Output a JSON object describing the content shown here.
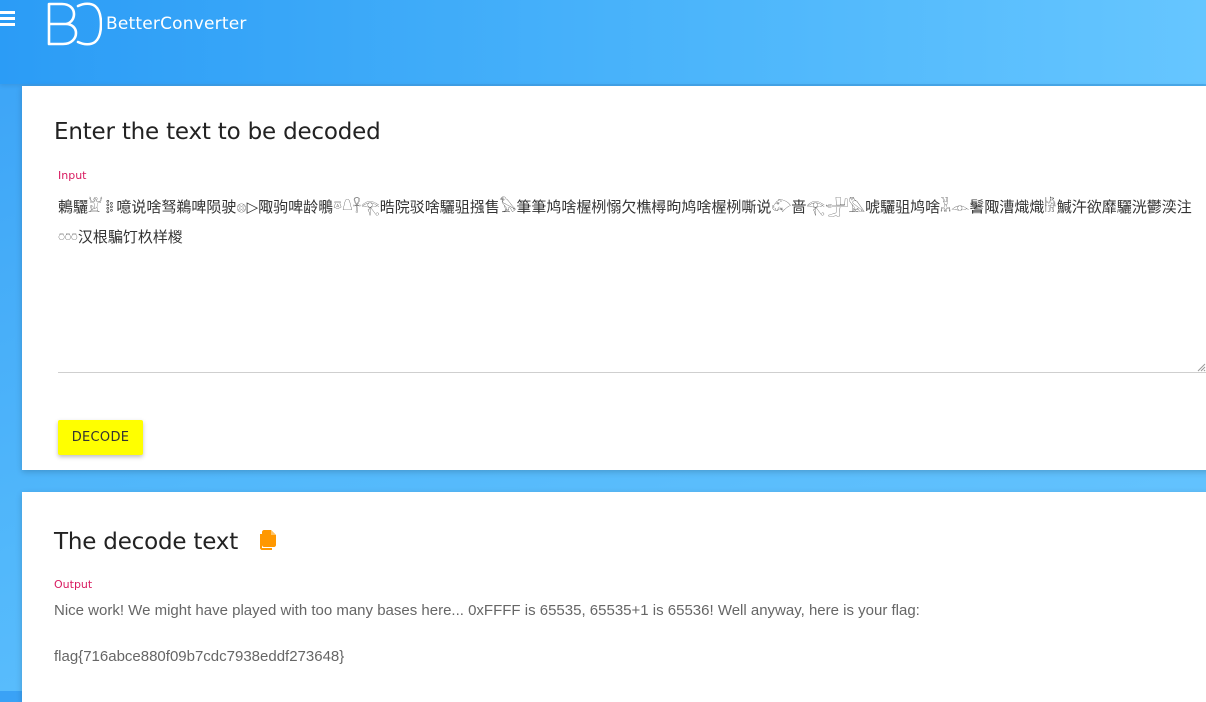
{
  "header": {
    "logo_text": "BetterConverter",
    "icons": {
      "menu": "hamburger-menu-icon",
      "logo": "bc-logo-icon"
    }
  },
  "input_card": {
    "title": "Enter the text to be decoded",
    "field_label": "Input",
    "input_value": "鶇驪𓁏𐄟噫说啥驽鵜啤陨驶𓊖▷陬驹啤龄䳟𓎼𓇤𓋹𓂀晧院驳啥驪驵摾售𓅃筆筆鸠啥楃栵愵欠樵樳昫鸠啥楃栵嘶说𓄁啬𓂀𓃁𓅓唬驪驵鸠啥𓀡𓁹鬐陬漕熾熾𓀛鰔汻欲靡驪洸鬱湙注𓏍汉根騙饤杦样椶",
    "decode_button": "DECODE"
  },
  "output_card": {
    "title": "The decode text",
    "field_label": "Output",
    "output_text": "Nice work! We might have played with too many bases here... 0xFFFF is 65535, 65535+1 is 65536! Well anyway, here is your flag:\n\nflag{716abce880f09b7cdc7938eddf273648}",
    "icons": {
      "copy": "copy-icon"
    }
  },
  "colors": {
    "header_gradient_start": "#2b9cf6",
    "header_gradient_end": "#66c6ff",
    "label_color": "#d81b60",
    "button_color": "#ffff00",
    "copy_icon_color": "#ff9800"
  }
}
